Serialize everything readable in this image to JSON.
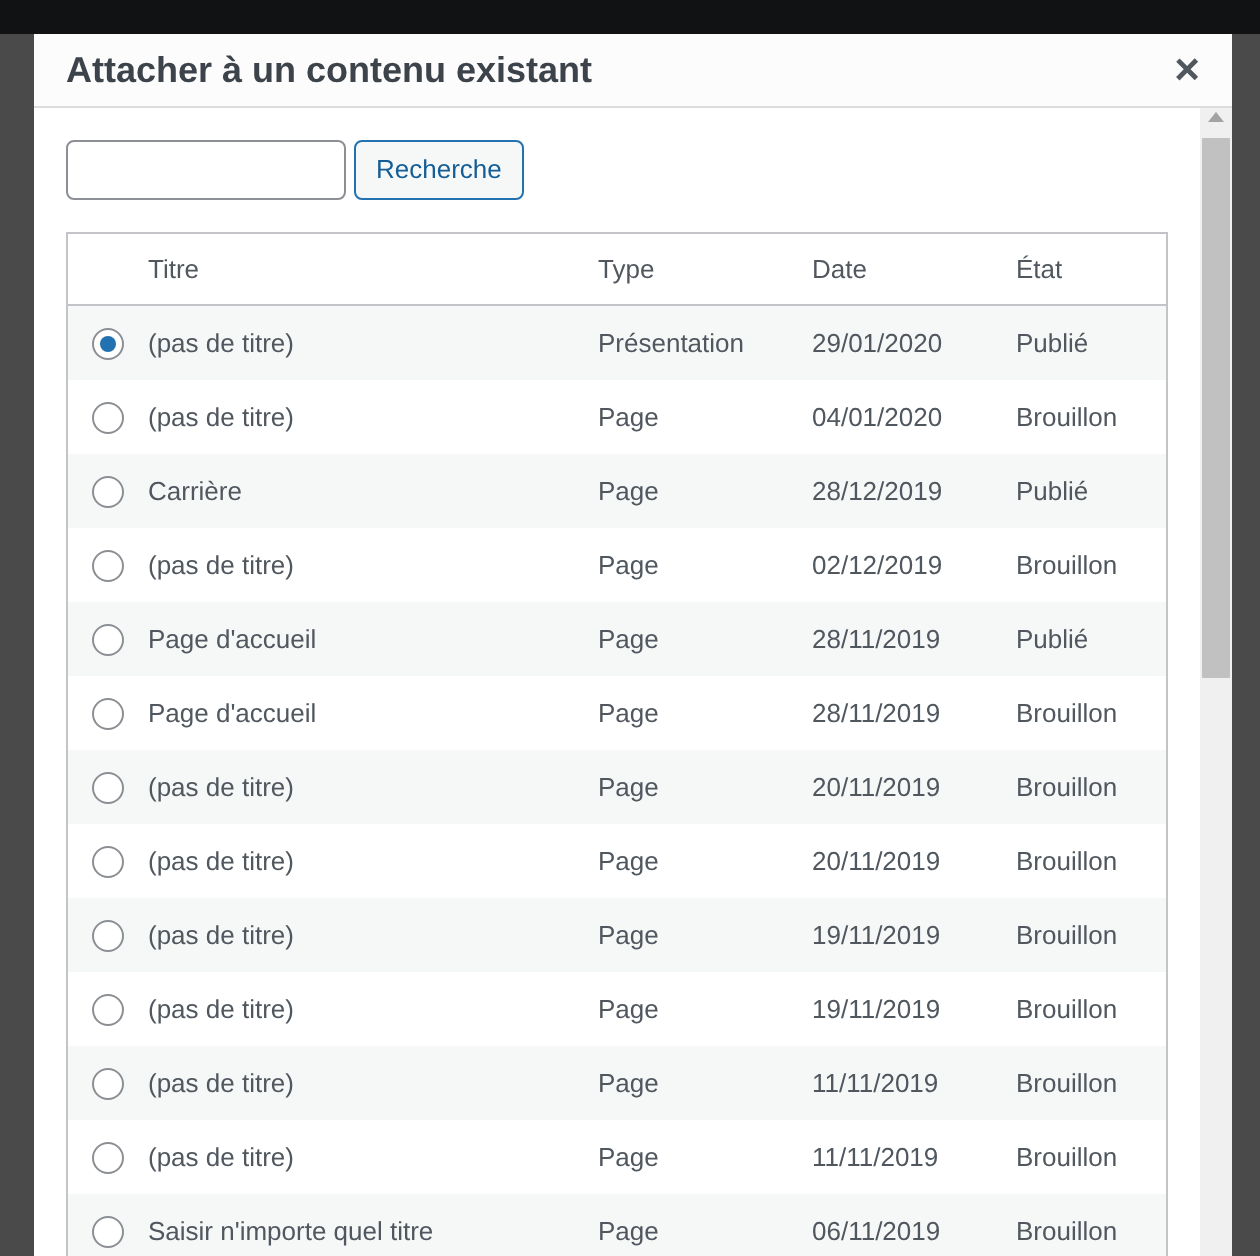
{
  "dialog": {
    "title": "Attacher à un contenu existant",
    "close": "×"
  },
  "search": {
    "button": "Recherche"
  },
  "table": {
    "columns": [
      "Titre",
      "Type",
      "Date",
      "État"
    ],
    "rows": [
      {
        "title": "(pas de titre)",
        "type": "Présentation",
        "date": "29/01/2020",
        "status": "Publié",
        "selected": true
      },
      {
        "title": "(pas de titre)",
        "type": "Page",
        "date": "04/01/2020",
        "status": "Brouillon",
        "selected": false
      },
      {
        "title": "Carrière",
        "type": "Page",
        "date": "28/12/2019",
        "status": "Publié",
        "selected": false
      },
      {
        "title": "(pas de titre)",
        "type": "Page",
        "date": "02/12/2019",
        "status": "Brouillon",
        "selected": false
      },
      {
        "title": "Page d'accueil",
        "type": "Page",
        "date": "28/11/2019",
        "status": "Publié",
        "selected": false
      },
      {
        "title": "Page d'accueil",
        "type": "Page",
        "date": "28/11/2019",
        "status": "Brouillon",
        "selected": false
      },
      {
        "title": "(pas de titre)",
        "type": "Page",
        "date": "20/11/2019",
        "status": "Brouillon",
        "selected": false
      },
      {
        "title": "(pas de titre)",
        "type": "Page",
        "date": "20/11/2019",
        "status": "Brouillon",
        "selected": false
      },
      {
        "title": "(pas de titre)",
        "type": "Page",
        "date": "19/11/2019",
        "status": "Brouillon",
        "selected": false
      },
      {
        "title": "(pas de titre)",
        "type": "Page",
        "date": "19/11/2019",
        "status": "Brouillon",
        "selected": false
      },
      {
        "title": "(pas de titre)",
        "type": "Page",
        "date": "11/11/2019",
        "status": "Brouillon",
        "selected": false
      },
      {
        "title": "(pas de titre)",
        "type": "Page",
        "date": "11/11/2019",
        "status": "Brouillon",
        "selected": false
      },
      {
        "title": "Saisir n'importe quel titre",
        "type": "Page",
        "date": "06/11/2019",
        "status": "Brouillon",
        "selected": false
      }
    ]
  }
}
